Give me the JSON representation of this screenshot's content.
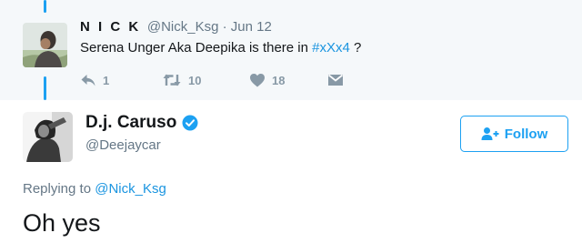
{
  "colors": {
    "accent": "#1da1f2",
    "link": "#1b95e0",
    "muted": "#657786",
    "action_gray": "#8899a6",
    "highlight_bg": "#f5f8fa"
  },
  "parent_tweet": {
    "name": "N I C K",
    "handle": "@Nick_Ksg",
    "separator": "·",
    "date": "Jun 12",
    "text_before": "Serena Unger Aka Deepika is there in ",
    "hashtag": "#xXx4",
    "text_after": " ?",
    "actions": {
      "reply": {
        "icon": "reply-icon",
        "count": "1"
      },
      "retweet": {
        "icon": "retweet-icon",
        "count": "10"
      },
      "like": {
        "icon": "heart-icon",
        "count": "18"
      },
      "message": {
        "icon": "direct-message-icon"
      }
    }
  },
  "main_tweet": {
    "name": "D.j. Caruso",
    "verified_icon": "verified-badge-icon",
    "handle": "@Deejaycar",
    "follow_label": "Follow",
    "follow_icon": "add-user-icon",
    "replying_prefix": "Replying to ",
    "replying_to": "@Nick_Ksg",
    "text": "Oh yes"
  }
}
